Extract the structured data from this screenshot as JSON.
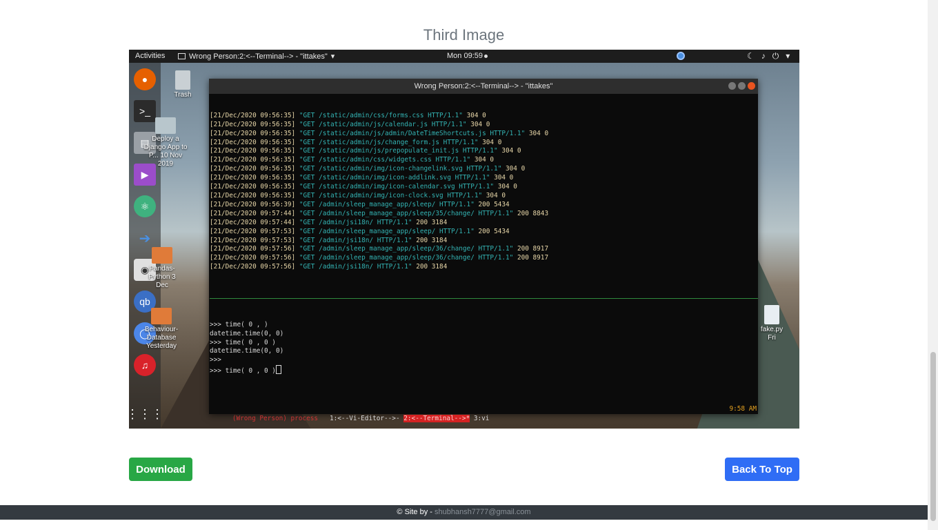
{
  "page": {
    "title": "Third Image",
    "download_label": "Download",
    "back_to_top_label": "Back To Top"
  },
  "footer": {
    "prefix": "© Site by - ",
    "email": "shubhansh7777@gmail.com"
  },
  "screenshot": {
    "topbar": {
      "activities": "Activities",
      "app_title": "Wrong Person:2:<--Terminal--> - \"ittakes\"",
      "clock": "Mon 09:59"
    },
    "desktop_items": [
      {
        "label": "Trash"
      },
      {
        "label": "Deploy a Django App to P... 10 Nov 2019"
      },
      {
        "label": "Pandas-Python 3 Dec"
      },
      {
        "label": "Behaviour-Database Yesterday"
      },
      {
        "label": "fake.py Fri"
      }
    ],
    "terminal": {
      "title": "Wrong Person:2:<--Terminal--> - \"ittakes\"",
      "log_lines": [
        {
          "ts": "[21/Dec/2020 09:56:35]",
          "req": "\"GET /static/admin/css/forms.css HTTP/1.1\"",
          "st": "304 0"
        },
        {
          "ts": "[21/Dec/2020 09:56:35]",
          "req": "\"GET /static/admin/js/calendar.js HTTP/1.1\"",
          "st": "304 0"
        },
        {
          "ts": "[21/Dec/2020 09:56:35]",
          "req": "\"GET /static/admin/js/admin/DateTimeShortcuts.js HTTP/1.1\"",
          "st": "304 0"
        },
        {
          "ts": "[21/Dec/2020 09:56:35]",
          "req": "\"GET /static/admin/js/change_form.js HTTP/1.1\"",
          "st": "304 0"
        },
        {
          "ts": "[21/Dec/2020 09:56:35]",
          "req": "\"GET /static/admin/js/prepopulate_init.js HTTP/1.1\"",
          "st": "304 0"
        },
        {
          "ts": "[21/Dec/2020 09:56:35]",
          "req": "\"GET /static/admin/css/widgets.css HTTP/1.1\"",
          "st": "304 0"
        },
        {
          "ts": "[21/Dec/2020 09:56:35]",
          "req": "\"GET /static/admin/img/icon-changelink.svg HTTP/1.1\"",
          "st": "304 0"
        },
        {
          "ts": "[21/Dec/2020 09:56:35]",
          "req": "\"GET /static/admin/img/icon-addlink.svg HTTP/1.1\"",
          "st": "304 0"
        },
        {
          "ts": "[21/Dec/2020 09:56:35]",
          "req": "\"GET /static/admin/img/icon-calendar.svg HTTP/1.1\"",
          "st": "304 0"
        },
        {
          "ts": "[21/Dec/2020 09:56:35]",
          "req": "\"GET /static/admin/img/icon-clock.svg HTTP/1.1\"",
          "st": "304 0"
        },
        {
          "ts": "[21/Dec/2020 09:56:39]",
          "req": "\"GET /admin/sleep_manage_app/sleep/ HTTP/1.1\"",
          "st": "200 5434"
        },
        {
          "ts": "[21/Dec/2020 09:57:44]",
          "req": "\"GET /admin/sleep_manage_app/sleep/35/change/ HTTP/1.1\"",
          "st": "200 8843"
        },
        {
          "ts": "[21/Dec/2020 09:57:44]",
          "req": "\"GET /admin/jsi18n/ HTTP/1.1\"",
          "st": "200 3184"
        },
        {
          "ts": "[21/Dec/2020 09:57:53]",
          "req": "\"GET /admin/sleep_manage_app/sleep/ HTTP/1.1\"",
          "st": "200 5434"
        },
        {
          "ts": "[21/Dec/2020 09:57:53]",
          "req": "\"GET /admin/jsi18n/ HTTP/1.1\"",
          "st": "200 3184"
        },
        {
          "ts": "[21/Dec/2020 09:57:56]",
          "req": "\"GET /admin/sleep_manage_app/sleep/36/change/ HTTP/1.1\"",
          "st": "200 8917"
        },
        {
          "ts": "[21/Dec/2020 09:57:56]",
          "req": "\"GET /admin/sleep_manage_app/sleep/36/change/ HTTP/1.1\"",
          "st": "200 8917"
        },
        {
          "ts": "[21/Dec/2020 09:57:56]",
          "req": "\"GET /admin/jsi18n/ HTTP/1.1\"",
          "st": "200 3184"
        }
      ],
      "repl_lines": [
        ">>> time( 0 , )",
        "datetime.time(0, 0)",
        ">>> time( 0 , 0 )",
        "datetime.time(0, 0)",
        ">>>",
        ">>> time( 0 , 0 )"
      ],
      "status": {
        "session": "(Wrong Person) process",
        "window1": "1:<--Vi-Editor-->-",
        "window2": "2:<--Terminal-->*",
        "window3": "3:vi",
        "time": "9:58 AM"
      }
    }
  },
  "colors": {
    "download": "#28a745",
    "back_to_top": "#2f6df5",
    "footer_bg": "#343a40"
  }
}
